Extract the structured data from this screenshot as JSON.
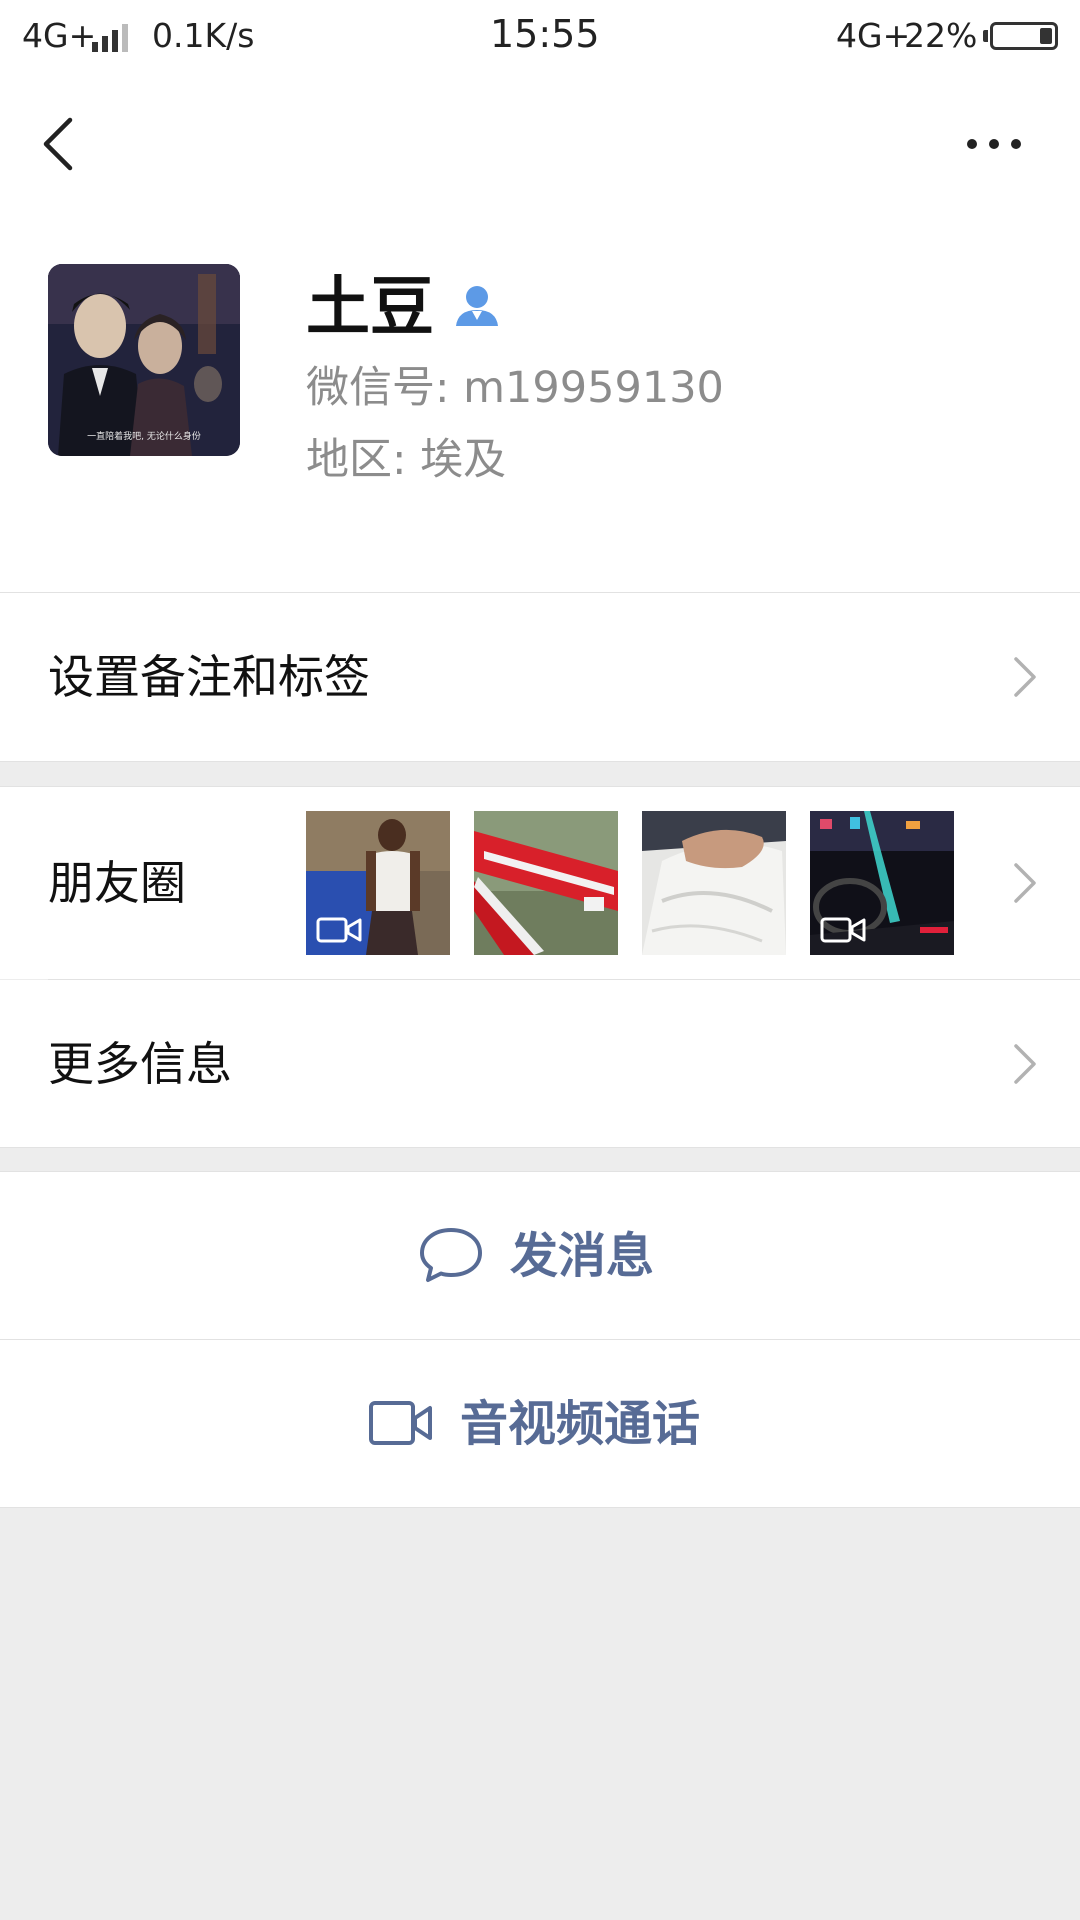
{
  "status_bar": {
    "network": "4G+",
    "speed": "0.1K/s",
    "time": "15:55",
    "network_right": "4G+",
    "battery": "22%",
    "battery_level": 0.22
  },
  "profile": {
    "name": "土豆",
    "wechat_id": "微信号: m19959130",
    "region": "地区: 埃及",
    "avatar_caption": "一直陪着我吧, 无论什么身份"
  },
  "rows": {
    "remark": "设置备注和标签",
    "moments": "朋友圈",
    "more": "更多信息"
  },
  "moments_thumbs": [
    {
      "name": "moments-thumb-1",
      "video": true
    },
    {
      "name": "moments-thumb-2",
      "video": false
    },
    {
      "name": "moments-thumb-3",
      "video": false
    },
    {
      "name": "moments-thumb-4",
      "video": true
    }
  ],
  "actions": {
    "message": "发消息",
    "call": "音视频通话"
  },
  "colors": {
    "accent": "#576b95",
    "background": "#ededed",
    "contact_icon": "#5d9ae6"
  },
  "icons": [
    "back-arrow-icon",
    "more-dots-icon",
    "contact-person-icon",
    "chevron-right-icon",
    "chat-bubble-icon",
    "video-camera-icon"
  ]
}
